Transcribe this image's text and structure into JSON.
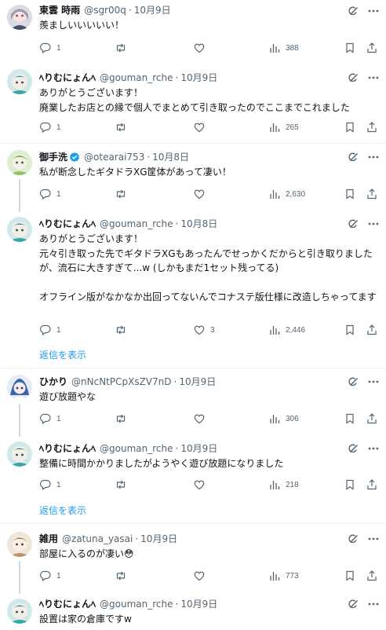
{
  "posts": [
    {
      "name": "東雲 時雨",
      "handle": "@sgr00q",
      "time": "10月9日",
      "text": "羨ましいいいいい！",
      "replies": "1",
      "retweets": "",
      "likes": "",
      "views": "388",
      "avatar": "gray-hair-girl",
      "verified": false
    },
    {
      "name": "ﾍりむにょんﾍ",
      "handle": "@gouman_rche",
      "time": "10月9日",
      "text": "ありがとうございます！\n廃業したお店との縁で個人でまとめて引き取ったのでここまでこれました",
      "replies": "1",
      "retweets": "",
      "likes": "",
      "views": "265",
      "avatar": "teal-character",
      "verified": false
    },
    {
      "name": "御手洗",
      "handle": "@otearai753",
      "time": "10月8日",
      "text": "私が断念したギタドラXG筐体があって凄い！",
      "replies": "1",
      "retweets": "",
      "likes": "",
      "views": "2,630",
      "avatar": "green-character",
      "verified": true
    },
    {
      "name": "ﾍりむにょんﾍ",
      "handle": "@gouman_rche",
      "time": "10月8日",
      "text": "ありがとうございます！\n元々引き取った先でギタドラXGもあったんでせっかくだからと引き取りましたが、流石に大きすぎて...w (しかもまだ1セット残ってる)\n\nオフライン版がなかなか出回ってないんでコナステ版仕様に改造しちゃってます",
      "replies": "1",
      "retweets": "",
      "likes": "3",
      "views": "2,446",
      "avatar": "teal-character",
      "verified": false
    },
    {
      "name": "ひかり",
      "handle": "@nNcNtPCpXsZV7nD",
      "time": "10月9日",
      "text": "遊び放題やな",
      "replies": "1",
      "retweets": "",
      "likes": "",
      "views": "306",
      "avatar": "blue-character",
      "verified": false
    },
    {
      "name": "ﾍりむにょんﾍ",
      "handle": "@gouman_rche",
      "time": "10月9日",
      "text": "整備に時間かかりましたがようやく遊び放題になりました",
      "replies": "1",
      "retweets": "",
      "likes": "",
      "views": "218",
      "avatar": "teal-character",
      "verified": false
    },
    {
      "name": "雑用",
      "handle": "@zatuna_yasai",
      "time": "10月9日",
      "text": "部屋に入るのが凄い😳",
      "replies": "1",
      "retweets": "",
      "likes": "",
      "views": "773",
      "avatar": "tan-character",
      "verified": false
    },
    {
      "name": "ﾍりむにょんﾍ",
      "handle": "@gouman_rche",
      "time": "10月9日",
      "text": "設置は家の倉庫ですw",
      "avatar": "teal-character",
      "verified": false
    }
  ],
  "show_replies_label": "返信を表示",
  "colors": {
    "text": "#0f1419",
    "secondary": "#536471",
    "link": "#1d9bf0",
    "divider": "#eff3f4",
    "thread_line": "#cfd9de"
  }
}
